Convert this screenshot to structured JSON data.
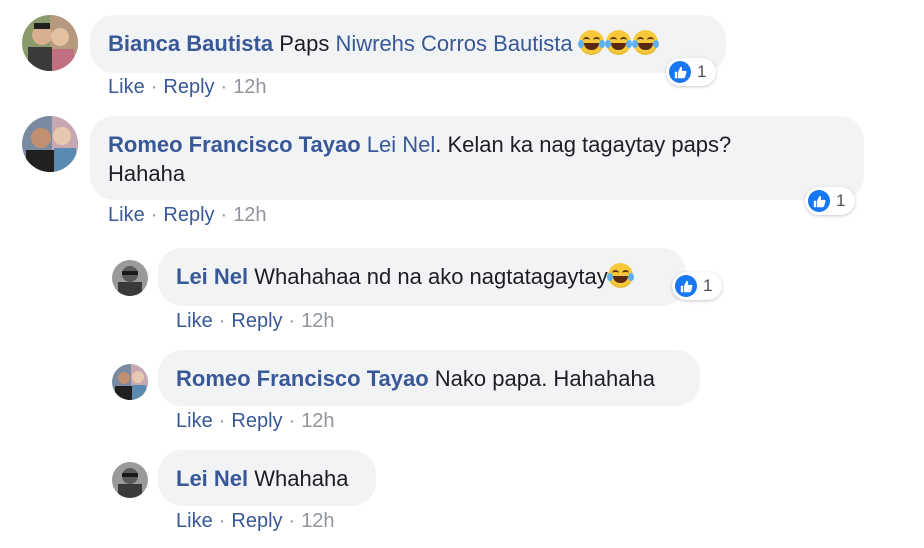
{
  "comments": [
    {
      "author": "Bianca Bautista",
      "text_parts": [
        "Paps ",
        "Niwrehs Corros Bautista",
        " "
      ],
      "like": "Like",
      "reply": "Reply",
      "time": "12h",
      "reaction_count": "1",
      "emoji": "laughing-tears-emoji"
    },
    {
      "author": "Romeo Francisco Tayao",
      "mention": "Lei Nel",
      "text": ". Kelan ka nag tagaytay paps?",
      "text2": "Hahaha",
      "like": "Like",
      "reply": "Reply",
      "time": "12h",
      "reaction_count": "1"
    },
    {
      "author": "Lei Nel",
      "text": "Whahahaa nd na ako nagtatagaytay",
      "like": "Like",
      "reply": "Reply",
      "time": "12h",
      "reaction_count": "1",
      "emoji": "laughing-tears-emoji"
    },
    {
      "author": "Romeo Francisco Tayao",
      "text": "Nako papa. Hahahaha",
      "like": "Like",
      "reply": "Reply",
      "time": "12h"
    },
    {
      "author": "Lei Nel",
      "text": "Whahaha",
      "like": "Like",
      "reply": "Reply",
      "time": "12h"
    }
  ],
  "separator": "·",
  "colors": {
    "link": "#385898",
    "bubble": "#f2f3f5",
    "like_blue": "#1877f2"
  }
}
